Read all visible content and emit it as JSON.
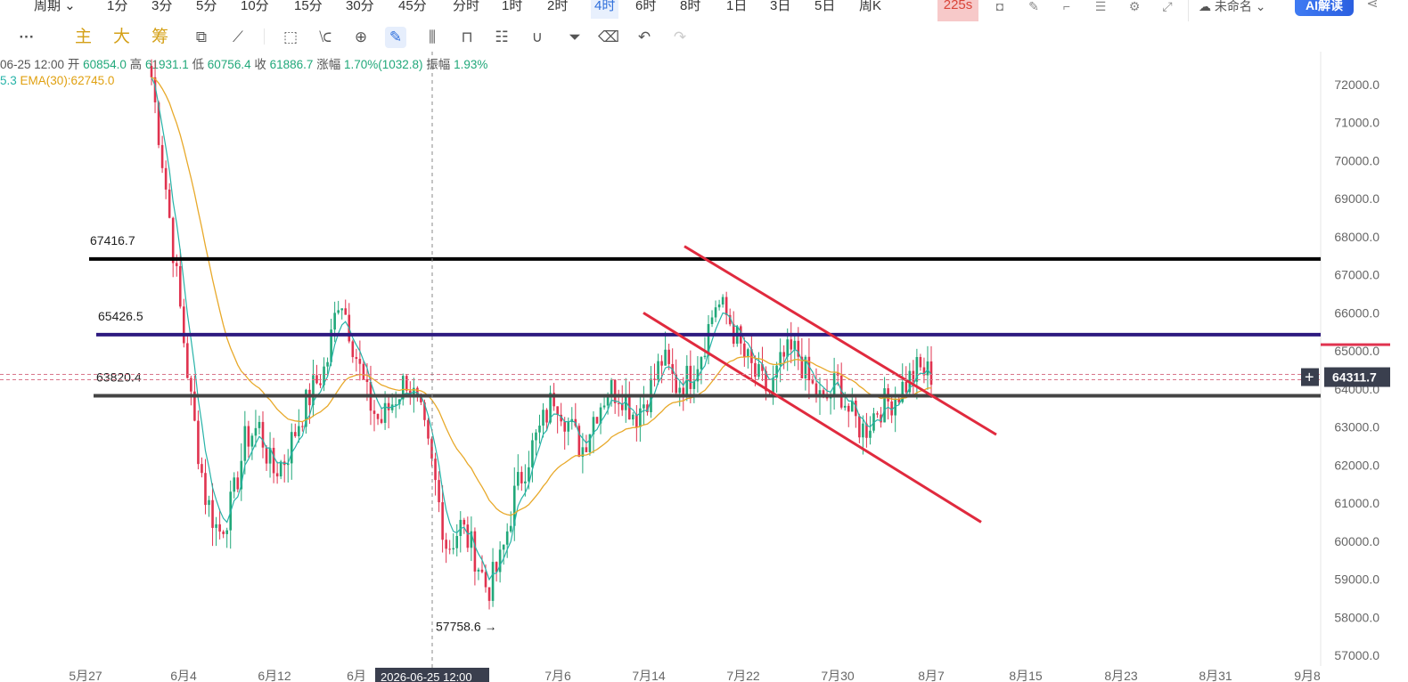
{
  "timeframes": [
    "周期",
    "1分",
    "3分",
    "5分",
    "10分",
    "15分",
    "30分",
    "45分",
    "分时",
    "1时",
    "2时",
    "4时",
    "6时",
    "8时",
    "1日",
    "3日",
    "5日",
    "周K"
  ],
  "active_timeframe": "4时",
  "replay_badge": "225s",
  "layout_name": "未命名",
  "ai_button": "AI解读",
  "indicator_labels": [
    "主",
    "大",
    "筹"
  ],
  "toolbar_icons": [
    "more-icon",
    "crop-icon",
    "ruler-icon",
    "zoom-in-icon",
    "draw-pen-icon",
    "candle-type-icon",
    "lock-icon",
    "edit-list-icon",
    "magnet-icon",
    "filter-icon",
    "trash-icon",
    "undo-icon",
    "redo-icon"
  ],
  "ohlc": {
    "date": "06-25 12:00",
    "open_label": "开",
    "open": "60854.0",
    "high_label": "高",
    "high": "61931.1",
    "low_label": "低",
    "low": "60756.4",
    "close_label": "收",
    "close": "61886.7",
    "change_label": "涨幅",
    "change": "1.70%(1032.8)",
    "amplitude_label": "振幅",
    "amplitude": "1.93%"
  },
  "ema_partial": "5.3",
  "ema_label": "EMA(30):62745.0",
  "colors": {
    "up": "#21a87a",
    "down": "#e0334f",
    "ema_fast": "#27b3a8",
    "ema_slow": "#e8a92a",
    "black_line": "#000000",
    "purple_line": "#2e1a80",
    "gray_line": "#444444",
    "channel": "#e02a3e",
    "current_price_bg": "#3a3f4e"
  },
  "chart_data": {
    "type": "candlestick",
    "yaxis_ticks": [
      57000,
      58000,
      59000,
      60000,
      61000,
      62000,
      63000,
      64000,
      65000,
      66000,
      67000,
      68000,
      69000,
      70000,
      71000,
      72000
    ],
    "ylim": [
      56800,
      72600
    ],
    "xaxis_labels": [
      "5月27",
      "6月4",
      "6月12",
      "6月",
      "7月6",
      "7月14",
      "7月22",
      "7月30",
      "8月7",
      "8月15",
      "8月23",
      "8月31",
      "9月8"
    ],
    "crosshair_date_label": "2026-06-25 12:00",
    "crosshair_price_label": "64311.7",
    "horizontal_levels": [
      {
        "name": "black-line",
        "value": 67416.7,
        "label": "67416.7"
      },
      {
        "name": "purple-line",
        "value": 65426.5,
        "label": "65426.5"
      },
      {
        "name": "gray-line",
        "value": 63820.4,
        "label": "63820.4"
      }
    ],
    "low_marker": {
      "value": 57758.6,
      "label": "57758.6"
    },
    "channel_lines": [
      {
        "from": [
          "7月19",
          67700
        ],
        "to": [
          "8月15",
          62700
        ]
      },
      {
        "from": [
          "7月9",
          66000
        ],
        "to": [
          "8月15",
          60500
        ]
      }
    ],
    "close_path": [
      72200,
      69500,
      66500,
      63500,
      61200,
      60200,
      61000,
      62700,
      63000,
      61800,
      62200,
      63200,
      64000,
      64600,
      66600,
      65200,
      63800,
      63100,
      63700,
      64300,
      63300,
      61700,
      59800,
      60400,
      59700,
      58700,
      59500,
      61200,
      62200,
      63000,
      63900,
      63100,
      62400,
      63400,
      64000,
      63900,
      63300,
      63900,
      64800,
      64100,
      64300,
      65100,
      66300,
      65800,
      64900,
      64300,
      63900,
      64800,
      65000,
      64100,
      63600,
      64200,
      63300,
      62900,
      63500,
      63700,
      64100,
      64500,
      64400
    ]
  }
}
